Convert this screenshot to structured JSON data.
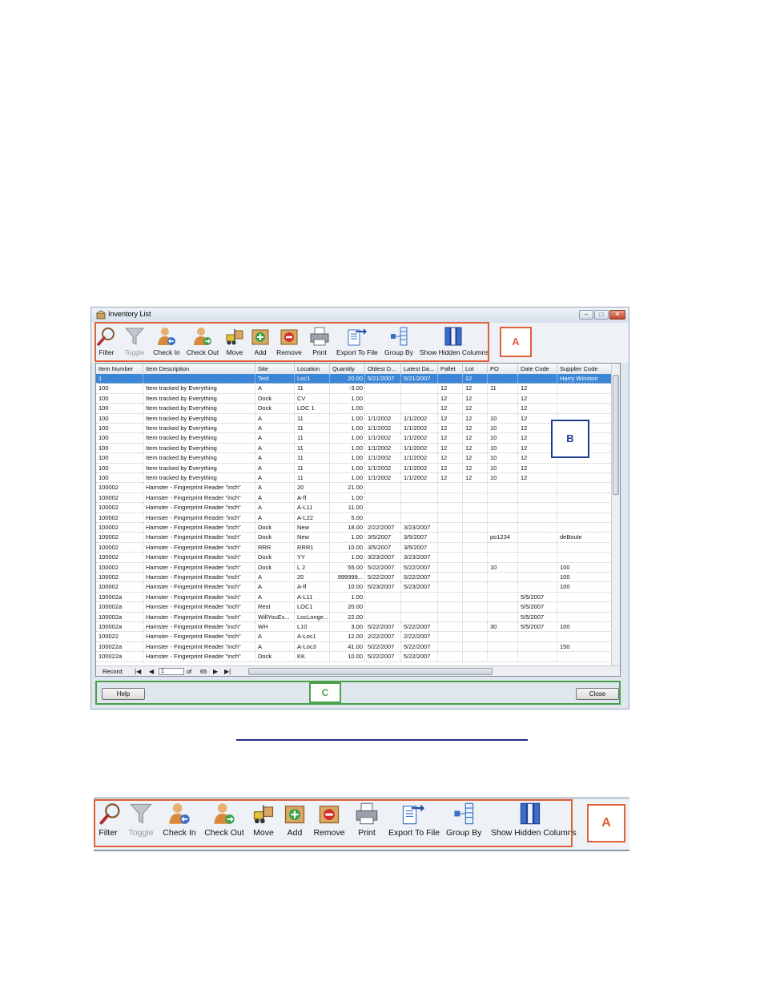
{
  "window": {
    "title": "Inventory List",
    "controls": {
      "minimize": "–",
      "maximize": "□",
      "close": "✕"
    }
  },
  "toolbar": {
    "buttons": [
      {
        "label": "Filter",
        "icon": "magnifier-icon",
        "enabled": true
      },
      {
        "label": "Toggle",
        "icon": "funnel-icon",
        "enabled": false
      },
      {
        "label": "Check In",
        "icon": "person-check-in-icon",
        "enabled": true
      },
      {
        "label": "Check Out",
        "icon": "person-check-out-icon",
        "enabled": true
      },
      {
        "label": "Move",
        "icon": "forklift-icon",
        "enabled": true
      },
      {
        "label": "Add",
        "icon": "add-box-icon",
        "enabled": true
      },
      {
        "label": "Remove",
        "icon": "remove-box-icon",
        "enabled": true
      },
      {
        "label": "Print",
        "icon": "printer-icon",
        "enabled": true
      },
      {
        "label": "Export To File",
        "icon": "export-file-icon",
        "enabled": true
      },
      {
        "label": "Group By",
        "icon": "group-by-icon",
        "enabled": true
      },
      {
        "label": "Show Hidden Columns",
        "icon": "columns-icon",
        "enabled": true
      }
    ]
  },
  "callouts": {
    "a": "A",
    "b": "B",
    "c": "C"
  },
  "grid": {
    "columns": [
      "Item Number",
      "Item Description",
      "Site",
      "Location",
      "Quantity",
      "Oldest D...",
      "Latest Da...",
      "Pallet",
      "Lot",
      "PO",
      "Date Code",
      "Supplier Code"
    ],
    "rows": [
      [
        "1",
        "",
        "Test",
        "Loc1",
        "20.00",
        "5/21/2007",
        "5/21/2007",
        "",
        "12",
        "",
        "",
        "Harry Winston"
      ],
      [
        "100",
        "Item tracked by Everything",
        "A",
        "11",
        "-3.00",
        "",
        "",
        "12",
        "12",
        "11",
        "12",
        ""
      ],
      [
        "100",
        "Item tracked by Everything",
        "Dock",
        "CV",
        "1.00",
        "",
        "",
        "12",
        "12",
        "",
        "12",
        ""
      ],
      [
        "100",
        "Item tracked by Everything",
        "Dock",
        "LOC 1",
        "1.00",
        "",
        "",
        "12",
        "12",
        "",
        "12",
        ""
      ],
      [
        "100",
        "Item tracked by Everything",
        "A",
        "11",
        "1.00",
        "1/1/2002",
        "1/1/2002",
        "12",
        "12",
        "10",
        "12",
        ""
      ],
      [
        "100",
        "Item tracked by Everything",
        "A",
        "11",
        "1.00",
        "1/1/2002",
        "1/1/2002",
        "12",
        "12",
        "10",
        "12",
        ""
      ],
      [
        "100",
        "Item tracked by Everything",
        "A",
        "11",
        "1.00",
        "1/1/2002",
        "1/1/2002",
        "12",
        "12",
        "10",
        "12",
        ""
      ],
      [
        "100",
        "Item tracked by Everything",
        "A",
        "11",
        "1.00",
        "1/1/2002",
        "1/1/2002",
        "12",
        "12",
        "10",
        "12",
        ""
      ],
      [
        "100",
        "Item tracked by Everything",
        "A",
        "11",
        "1.00",
        "1/1/2002",
        "1/1/2002",
        "12",
        "12",
        "10",
        "12",
        ""
      ],
      [
        "100",
        "Item tracked by Everything",
        "A",
        "11",
        "1.00",
        "1/1/2002",
        "1/1/2002",
        "12",
        "12",
        "10",
        "12",
        ""
      ],
      [
        "100",
        "Item tracked by Everything",
        "A",
        "11",
        "1.00",
        "1/1/2002",
        "1/1/2002",
        "12",
        "12",
        "10",
        "12",
        ""
      ],
      [
        "100002",
        "Hamster - Fingerprint Reader \"inch\"",
        "A",
        "20",
        "21.00",
        "",
        "",
        "",
        "",
        "",
        "",
        ""
      ],
      [
        "100002",
        "Hamster - Fingerprint Reader \"inch\"",
        "A",
        "A-fl",
        "1.00",
        "",
        "",
        "",
        "",
        "",
        "",
        ""
      ],
      [
        "100002",
        "Hamster - Fingerprint Reader \"inch\"",
        "A",
        "A-L11",
        "11.00",
        "",
        "",
        "",
        "",
        "",
        "",
        ""
      ],
      [
        "100002",
        "Hamster - Fingerprint Reader \"inch\"",
        "A",
        "A-L22",
        "5.00",
        "",
        "",
        "",
        "",
        "",
        "",
        ""
      ],
      [
        "100002",
        "Hamster - Fingerprint Reader \"inch\"",
        "Dock",
        "New",
        "18.00",
        "2/22/2007",
        "3/23/2007",
        "",
        "",
        "",
        "",
        ""
      ],
      [
        "100002",
        "Hamster - Fingerprint Reader \"inch\"",
        "Dock",
        "New",
        "1.00",
        "3/5/2007",
        "3/5/2007",
        "",
        "",
        "po1234",
        "",
        "deBoule"
      ],
      [
        "100002",
        "Hamster - Fingerprint Reader \"inch\"",
        "RRR",
        "RRR1",
        "10.00",
        "3/5/2007",
        "3/5/2007",
        "",
        "",
        "",
        "",
        ""
      ],
      [
        "100002",
        "Hamster - Fingerprint Reader \"inch\"",
        "Dock",
        "YY",
        "1.00",
        "3/23/2007",
        "3/23/2007",
        "",
        "",
        "",
        "",
        ""
      ],
      [
        "100002",
        "Hamster - Fingerprint Reader \"inch\"",
        "Dock",
        "L 2",
        "55.00",
        "5/22/2007",
        "5/22/2007",
        "",
        "",
        "10",
        "",
        "100"
      ],
      [
        "100002",
        "Hamster - Fingerprint Reader \"inch\"",
        "A",
        "20",
        "999999...",
        "5/22/2007",
        "5/22/2007",
        "",
        "",
        "",
        "",
        "100"
      ],
      [
        "100002",
        "Hamster - Fingerprint Reader \"inch\"",
        "A",
        "A-fl",
        "10.00",
        "5/23/2007",
        "5/23/2007",
        "",
        "",
        "",
        "",
        "100"
      ],
      [
        "100002a",
        "Hamster - Fingerprint Reader \"inch\"",
        "A",
        "A-L11",
        "1.00",
        "",
        "",
        "",
        "",
        "",
        "5/5/2007",
        ""
      ],
      [
        "100002a",
        "Hamster - Fingerprint Reader \"inch\"",
        "Rest",
        "LOC1",
        "20.00",
        "",
        "",
        "",
        "",
        "",
        "5/5/2007",
        ""
      ],
      [
        "100002a",
        "Hamster - Fingerprint Reader \"inch\"",
        "WillYouEx...",
        "LocLonge...",
        "22.00",
        "",
        "",
        "",
        "",
        "",
        "5/5/2007",
        ""
      ],
      [
        "100002a",
        "Hamster - Fingerprint Reader \"inch\"",
        "WH",
        "L10",
        "3.00",
        "5/22/2007",
        "5/22/2007",
        "",
        "",
        "30",
        "5/5/2007",
        "100"
      ],
      [
        "100022",
        "Hamster - Fingerprint Reader \"inch\"",
        "A",
        "A-Loc1",
        "12.00",
        "2/22/2007",
        "2/22/2007",
        "",
        "",
        "",
        "",
        ""
      ],
      [
        "100022a",
        "Hamster - Fingerprint Reader \"inch\"",
        "A",
        "A-Loc3",
        "41.00",
        "5/22/2007",
        "5/22/2007",
        "",
        "",
        "",
        "",
        "150"
      ],
      [
        "100022a",
        "Hamster - Fingerprint Reader \"inch\"",
        "Dock",
        "KK",
        "10.00",
        "5/22/2007",
        "5/22/2007",
        "",
        "",
        "",
        "",
        ""
      ]
    ],
    "selected_row": 0,
    "navigator": {
      "label": "Record:",
      "current": "1",
      "of": "of",
      "total": "65"
    }
  },
  "footer": {
    "help": "Help",
    "close": "Close"
  }
}
